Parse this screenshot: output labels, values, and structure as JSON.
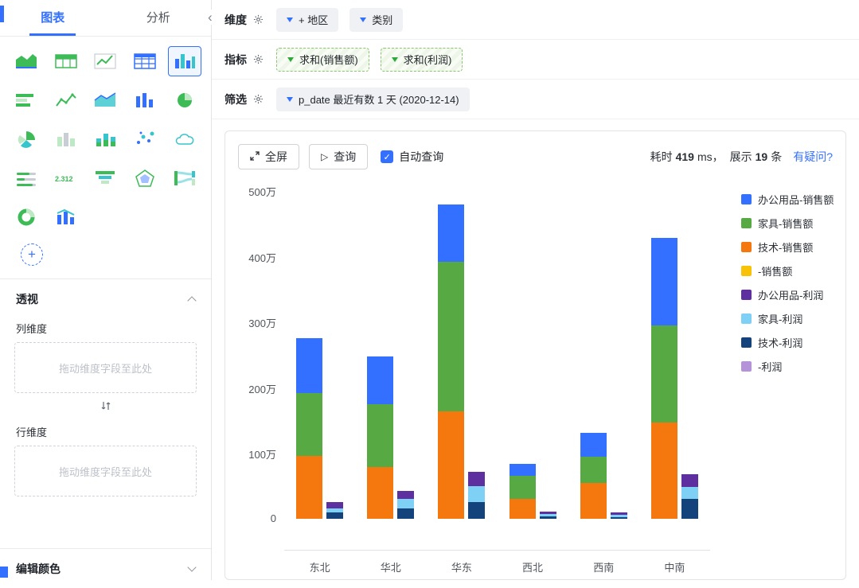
{
  "sidebar": {
    "tabs": [
      {
        "label": "图表"
      },
      {
        "label": "分析"
      }
    ],
    "active_tab": 0,
    "chart_types": [
      "area-chart",
      "summary-table",
      "trend-table",
      "data-table",
      "histogram",
      "horizontal-bar",
      "line-chart",
      "area-line",
      "column-chart",
      "pie-chart",
      "rose-chart",
      "map-3d",
      "stacked-column",
      "scatter-plot",
      "word-cloud",
      "progress-bar",
      "metric-card",
      "funnel",
      "radar",
      "sankey",
      "donut",
      "combo-chart"
    ],
    "selected_chart_index": 4,
    "metric_icon_text": "2.312",
    "pivot": {
      "title": "透视",
      "column_dimension_label": "列维度",
      "column_drop_placeholder": "拖动维度字段至此处",
      "row_dimension_label": "行维度",
      "row_drop_placeholder": "拖动维度字段至此处"
    },
    "edit_color_label": "编辑颜色"
  },
  "query_builder": {
    "dimension": {
      "label": "维度",
      "chips": [
        "+ 地区",
        "类别"
      ]
    },
    "metric": {
      "label": "指标",
      "chips": [
        "求和(销售额)",
        "求和(利润)"
      ]
    },
    "filter": {
      "label": "筛选",
      "chips": [
        "p_date 最近有数 1 天 (2020-12-14)"
      ]
    }
  },
  "toolbar": {
    "fullscreen_label": "全屏",
    "query_label": "查询",
    "auto_query_label": "自动查询",
    "auto_query_checked": true,
    "stats": {
      "elapsed_label": "耗时",
      "elapsed_value": "419",
      "elapsed_unit": "ms，",
      "shown_label": "展示",
      "shown_value": "19",
      "shown_unit": "条"
    },
    "help_link": "有疑问?"
  },
  "chart_data": {
    "type": "bar",
    "stacked": true,
    "unit": "万",
    "categories": [
      "东北",
      "华北",
      "华东",
      "西北",
      "西南",
      "中南"
    ],
    "ylim": [
      0,
      500
    ],
    "yticks": [
      "500万",
      "400万",
      "300万",
      "200万",
      "100万",
      "0"
    ],
    "legend_position": "right",
    "legend": [
      {
        "label": "办公用品-销售额",
        "color": "#3370ff"
      },
      {
        "label": "家具-销售额",
        "color": "#57a944"
      },
      {
        "label": "技术-销售额",
        "color": "#f5780f"
      },
      {
        "label": "-销售额",
        "color": "#f8c307"
      },
      {
        "label": "办公用品-利润",
        "color": "#5e2f9e"
      },
      {
        "label": "家具-利润",
        "color": "#7ed0f5"
      },
      {
        "label": "技术-利润",
        "color": "#14437c"
      },
      {
        "label": "-利润",
        "color": "#b493d8"
      }
    ],
    "groups": [
      {
        "name": "销售额",
        "series": [
          {
            "name": "技术-销售额",
            "color": "#f5780f",
            "values": [
              96,
              79,
              163,
              30,
              54,
              146
            ]
          },
          {
            "name": "家具-销售额",
            "color": "#57a944",
            "values": [
              95,
              95,
              228,
              35,
              41,
              148
            ]
          },
          {
            "name": "办公用品-销售额",
            "color": "#3370ff",
            "values": [
              84,
              73,
              87,
              18,
              36,
              133
            ]
          },
          {
            "name": "-销售额",
            "color": "#f8c307",
            "values": [
              0,
              0,
              0,
              0,
              0,
              0
            ]
          }
        ]
      },
      {
        "name": "利润",
        "series": [
          {
            "name": "技术-利润",
            "color": "#14437c",
            "values": [
              10,
              16,
              25,
              4,
              3,
              30
            ]
          },
          {
            "name": "家具-利润",
            "color": "#7ed0f5",
            "values": [
              6,
              14,
              25,
              3,
              3,
              18
            ]
          },
          {
            "name": "办公用品-利润",
            "color": "#5e2f9e",
            "values": [
              10,
              12,
              21,
              4,
              4,
              20
            ]
          },
          {
            "name": "-利润",
            "color": "#b493d8",
            "values": [
              0,
              0,
              0,
              0,
              0,
              0
            ]
          }
        ]
      }
    ]
  }
}
